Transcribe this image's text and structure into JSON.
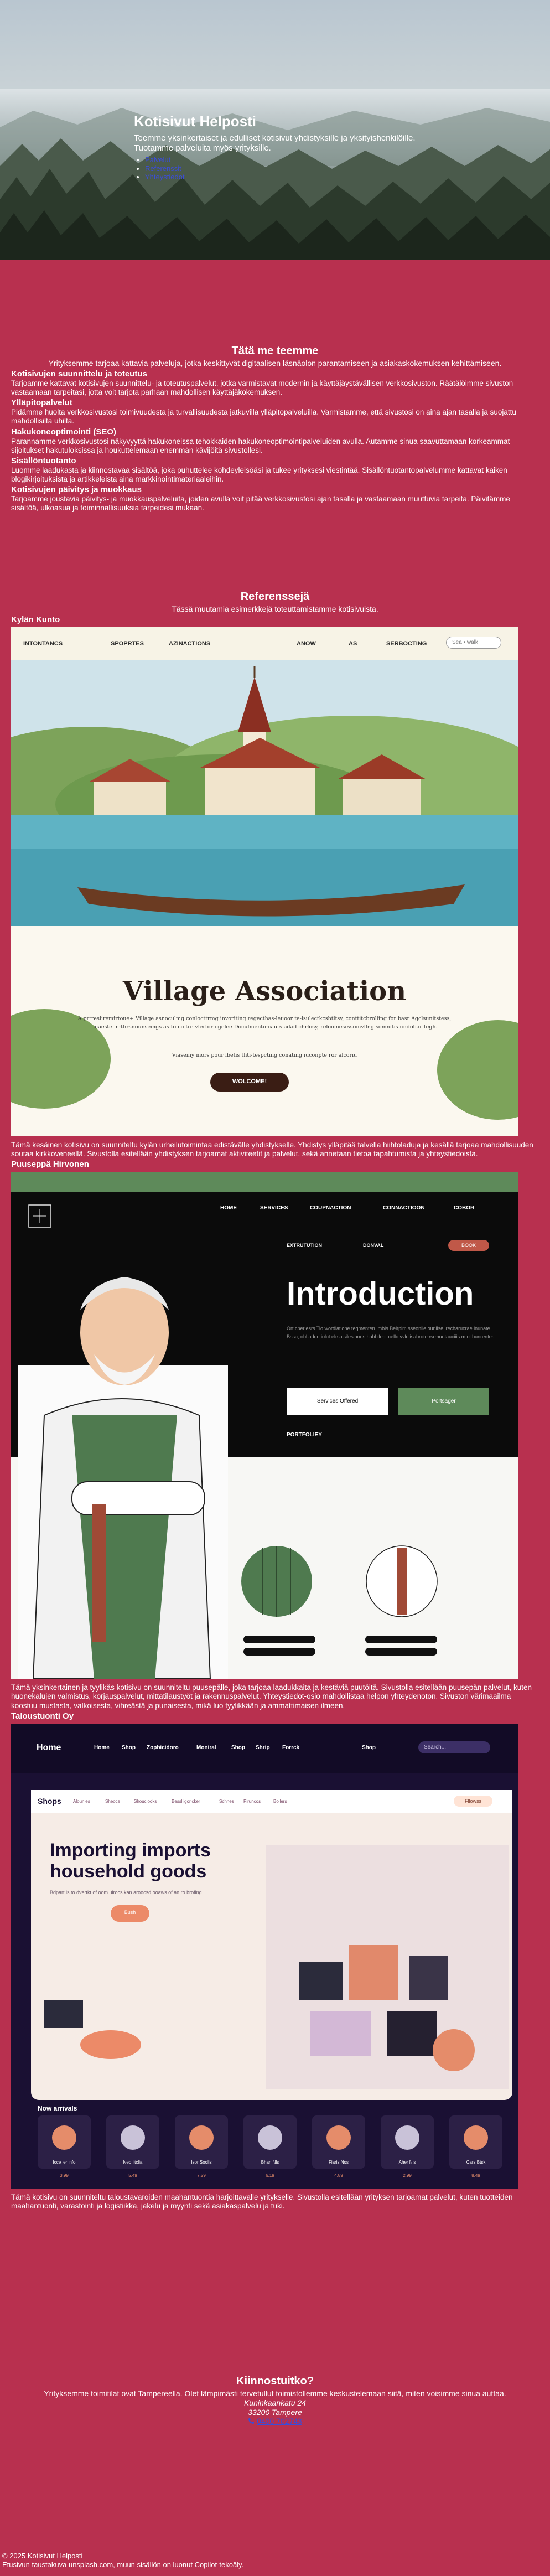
{
  "hero": {
    "title": "Kotisivut Helposti",
    "subtitle": "Teemme yksinkertaiset ja edulliset kotisivut yhdistyksille ja yksityishenkilöille. Tuotamme palveluita myös yrityksille.",
    "nav": [
      "Palvelut",
      "Referenssit",
      "Yhteystiedot"
    ]
  },
  "services": {
    "title": "Tätä me teemme",
    "intro": "Yrityksemme tarjoaa kattavia palveluja, jotka keskittyvät digitaalisen läsnäolon parantamiseen ja asiakaskokemuksen kehittämiseen.",
    "items": [
      {
        "title": "Kotisivujen suunnittelu ja toteutus",
        "text": "Tarjoamme kattavat kotisivujen suunnittelu- ja toteutuspalvelut, jotka varmistavat modernin ja käyttäjäystävällisen verkkosivuston. Räätälöimme sivuston vastaamaan tarpeitasi, jotta voit tarjota parhaan mahdollisen käyttäjäkokemuksen."
      },
      {
        "title": "Ylläpitopalvelut",
        "text": "Pidämme huolta verkkosivustosi toimivuudesta ja turvallisuudesta jatkuvilla ylläpitopalveluilla. Varmistamme, että sivustosi on aina ajan tasalla ja suojattu mahdollisilta uhilta."
      },
      {
        "title": "Hakukoneoptimointi (SEO)",
        "text": "Parannamme verkkosivustosi näkyvyyttä hakukoneissa tehokkaiden hakukoneoptimointipalveluiden avulla. Autamme sinua saavuttamaan korkeammat sijoitukset hakutuloksissa ja houkuttelemaan enemmän kävijöitä sivustollesi."
      },
      {
        "title": "Sisällöntuotanto",
        "text": "Luomme laadukasta ja kiinnostavaa sisältöä, joka puhuttelee kohdeyleisöäsi ja tukee yrityksesi viestintää. Sisällöntuotantopalvelumme kattavat kaiken blogikirjoituksista ja artikkeleista aina markkinointimateriaaleihin."
      },
      {
        "title": "Kotisivujen päivitys ja muokkaus",
        "text": "Tarjoamme joustavia päivitys- ja muokkauspalveluita, joiden avulla voit pitää verkkosivustosi ajan tasalla ja vastaamaan muuttuvia tarpeita. Päivitämme sisältöä, ulkoasua ja toiminnallisuuksia tarpeidesi mukaan."
      }
    ]
  },
  "references": {
    "title": "Referenssejä",
    "intro": "Tässä muutamia esimerkkejä toteuttamistamme kotisivuista.",
    "items": [
      {
        "name": "Kylän Kunto",
        "text": "Tämä kesäinen kotisivu on suunniteltu kylän urheilutoimintaa edistävälle yhdistykselle. Yhdistys ylläpitää talvella hiihtoladuja ja kesällä tarjoaa mahdollisuuden soutaa kirkkoveneellä. Sivustolla esitellään yhdistyksen tarjoamat aktiviteetit ja palvelut, sekä annetaan tietoa tapahtumista ja yhteystiedoista.",
        "mock": {
          "nav": [
            "INTONTANCS",
            "SPOPRTES",
            "AZINACTIONS",
            "ANOW",
            "AS",
            "SERBOCTING"
          ],
          "search": "Sea • walk",
          "headline": "Village Association",
          "body": "A prtresliremirtoue+ Village asnoculmg conlocttrmg invoriting regecthas-leuoor te-lsulectkcsbtltsy, conttitcbrolling for basr Agclsunitstess, auaeste in-thrsnounsemgs as to co tre vlertorlogelee Doculmento-cautsiadad chrlosy, reloomesrssomvllng somnitis undobar tegh.",
          "body2": "Viaseiny mors pour lbetis thti-tespcting conating iuconpte ror alcoriu",
          "cta": "WOLCOME!"
        }
      },
      {
        "name": "Puuseppä Hirvonen",
        "text": "Tämä yksinkertainen ja tyylikäs kotisivu on suunniteltu puusepälle, joka tarjoaa laadukkaita ja kestäviä puutöitä. Sivustolla esitellään puusepän palvelut, kuten huonekalujen valmistus, korjauspalvelut, mittatilaustyöt ja rakennuspalvelut. Yhteystiedot-osio mahdollistaa helpon yhteydenoton. Sivuston värimaailma koostuu mustasta, valkoisesta, vihreästä ja punaisesta, mikä luo tyylikkään ja ammattimaisen ilmeen.",
        "mock": {
          "nav": [
            "HOME",
            "SERVICES",
            "COUPNACTION",
            "CONNACTIOON",
            "COBOR"
          ],
          "subnav": [
            "EXTRUTUTION",
            "DONVAL"
          ],
          "subnav_button": "BOOK",
          "headline": "Introduction",
          "body": "Ort cperiesrs Tio wordiatione tegmenten. mbis Belrpim sseonlie ounlise lrecharucrae lnunate Bssa, obl aduotiolut elrsaisilesiaons habbileg. cello vvldiisabrote rsrrnuntauciiis m ol bunrentes.",
          "btn1": "Services Offered",
          "btn2": "Portsager",
          "portfolio": "PORTFOLIEY"
        }
      },
      {
        "name": "Taloustuonti Oy",
        "text": "Tämä kotisivu on suunniteltu taloustavaroiden maahantuontia harjoittavalle yritykselle. Sivustolla esitellään yrityksen tarjoamat palvelut, kuten tuotteiden maahantuonti, varastointi ja logistiikka, jakelu ja myynti sekä asiakaspalvelu ja tuki.",
        "mock": {
          "logo": "Home",
          "nav": [
            "Home",
            "Shop",
            "Zopbicidoro",
            "Moniral",
            "Shop",
            "Shrip",
            "Forrck"
          ],
          "nav_right": "Shop",
          "search": "Search...",
          "brand": "Shops",
          "subnav": [
            "Alounies",
            "Sheoce",
            "Shouclooks",
            "Bessliigoricker",
            "Schnes",
            "Piruncos",
            "Bollers"
          ],
          "subnav_button": "Fllowss",
          "headline": "Importing imports household goods",
          "body": "Bdpart is to dvertkt of oom ulrocs kan aroocsd ooaws of an ro brofing.",
          "cta": "Bush",
          "arrivals_title": "Now arrivals",
          "arrivals": [
            {
              "name": "Icce ier info",
              "price": "3.99"
            },
            {
              "name": "Neo litclia",
              "price": "5.49"
            },
            {
              "name": "Isor Soolis",
              "price": "7.29"
            },
            {
              "name": "Bharl Nls",
              "price": "6.19"
            },
            {
              "name": "Fiaris Nos",
              "price": "4.89"
            },
            {
              "name": "Aher Nis",
              "price": "2.99"
            },
            {
              "name": "Cars Btsk",
              "price": "8.49"
            }
          ]
        }
      }
    ]
  },
  "contact": {
    "title": "Kiinnostuitko?",
    "text": "Yrityksemme toimitilat ovat Tampereella. Olet lämpimästi tervetullut toimistollemme keskustelemaan siitä, miten voisimme sinua auttaa.",
    "street": "Kuninkaankatu 24",
    "city": "33200 Tampere",
    "phone_icon": "phone-icon",
    "phone": "0400 702743"
  },
  "footer": {
    "copyright": "© 2025 Kotisivut Helposti",
    "credits": "Etusivun taustakuva unsplash.com, muun sisällön on luonut Copilot-tekoäly."
  },
  "colors": {
    "background": "#b8304f",
    "link": "#3b4dd6",
    "text": "#ffffff"
  }
}
